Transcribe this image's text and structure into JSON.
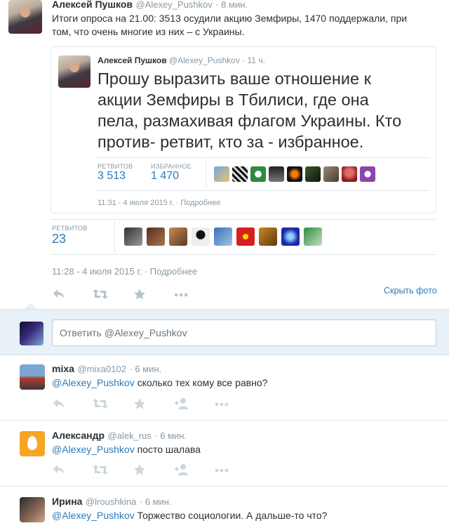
{
  "main_tweet": {
    "author": "Алексей Пушков",
    "handle": "@Alexey_Pushkov",
    "time": "· 8 мин.",
    "text_line1": "Итоги опроса на 21.00: 3513 осудили акцию Земфиры, 1470 поддержали, при",
    "text_line2": "том, что очень многие из них – с Украины.",
    "timestamp": "11:28 - 4 июля 2015 г.",
    "details_link": "· Подробнее",
    "hide_photo": "Скрыть фото",
    "retweets_label": "РЕТВИТОВ",
    "retweets_count": "23"
  },
  "quoted_tweet": {
    "author": "Алексей Пушков",
    "handle": "@Alexey_Pushkov",
    "time": "· 11 ч.",
    "text_line1": "Прошу выразить ваше отношение к",
    "text_line2": "акции Земфиры в Тбилиси, где она",
    "text_line3": "пела, размахивая флагом Украины. Кто",
    "text_line4": "против- ретвит, кто за - избранное.",
    "retweets_label": "РЕТВИТОВ",
    "retweets_count": "3 513",
    "favorites_label": "ИЗБРАННОЕ",
    "favorites_count": "1 470",
    "timestamp": "11:31 - 4 июля 2015 г.",
    "details_link": "· Подробнее"
  },
  "reply_box": {
    "placeholder": "Ответить @Alexey_Pushkov"
  },
  "replies": [
    {
      "author": "mixa",
      "handle": "@mixa0102",
      "time": "· 6 мин.",
      "mention": "@Alexey_Pushkov",
      "text": " сколько тех кому все равно?"
    },
    {
      "author": "Александр",
      "handle": "@alek_rus",
      "time": "· 6 мин.",
      "mention": "@Alexey_Pushkov",
      "text": " посто шалава"
    },
    {
      "author": "Ирина",
      "handle": "@lroushkina",
      "time": "· 6 мин.",
      "mention": "@Alexey_Pushkov",
      "text": " Торжество социологии. А дальше-то что?"
    }
  ],
  "colors": {
    "link": "#2b7bb9",
    "muted": "#8899a6",
    "reply_bg": "#e8f1f8",
    "egg": "#f5a623"
  }
}
